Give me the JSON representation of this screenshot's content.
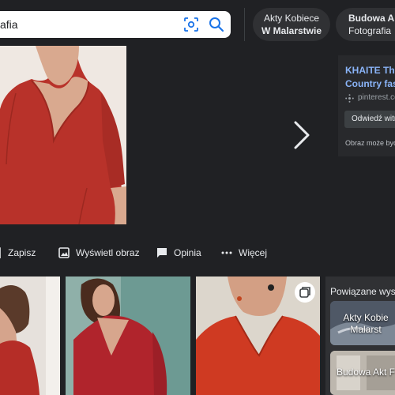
{
  "search": {
    "query": "afia"
  },
  "chips": [
    {
      "line1": "Akty Kobiece",
      "line2": "W Malarstwie"
    },
    {
      "line1": "Budowa Akt",
      "line2": "Fotografia"
    }
  ],
  "result": {
    "title": "KHAITE The\nCountry fash",
    "source": "pinterest.co",
    "visit_label": "Odwiedź witryn",
    "copyright_note": "Obraz może być"
  },
  "actions": {
    "save": "Zapisz",
    "view_image": "Wyświetl obraz",
    "feedback": "Opinia",
    "more": "Więcej"
  },
  "related": {
    "heading": "Powiązane wyszu",
    "items": [
      {
        "line1": "Akty Kobie",
        "line2": "Malarst"
      },
      {
        "line1": "Budowa Akt F",
        "line2": ""
      }
    ]
  },
  "colors": {
    "background": "#202124",
    "link": "#8ab4f8",
    "dress_red": "#b8322a"
  }
}
